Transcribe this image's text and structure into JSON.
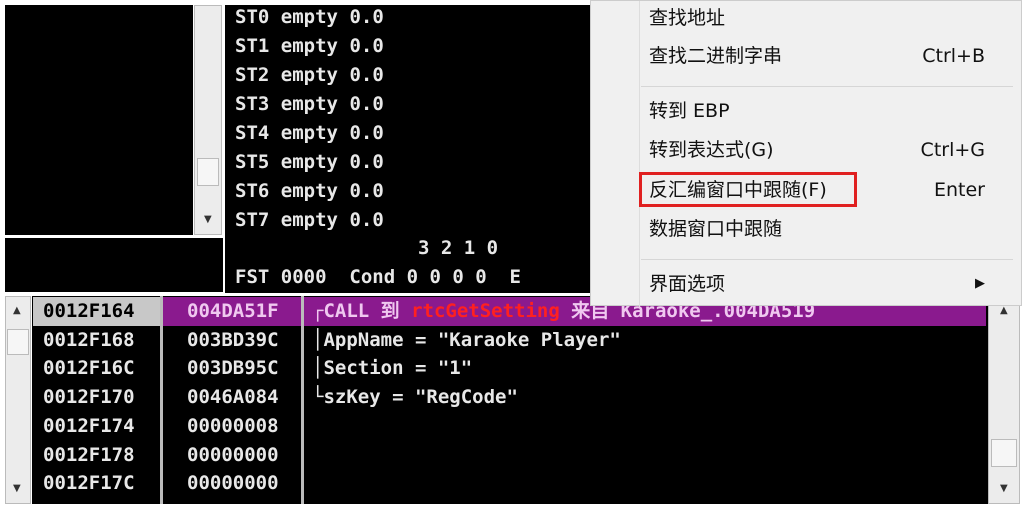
{
  "fpu": {
    "registers": [
      {
        "name": "ST0",
        "state": "empty",
        "value": "0.0"
      },
      {
        "name": "ST1",
        "state": "empty",
        "value": "0.0"
      },
      {
        "name": "ST2",
        "state": "empty",
        "value": "0.0"
      },
      {
        "name": "ST3",
        "state": "empty",
        "value": "0.0"
      },
      {
        "name": "ST4",
        "state": "empty",
        "value": "0.0"
      },
      {
        "name": "ST5",
        "state": "empty",
        "value": "0.0"
      },
      {
        "name": "ST6",
        "state": "empty",
        "value": "0.0"
      },
      {
        "name": "ST7",
        "state": "empty",
        "value": "0.0"
      }
    ],
    "bit_header": "                3 2 1 0",
    "fst_line": "FST 0000  Cond 0 0 0 0  E"
  },
  "stack": {
    "rows": [
      {
        "addr": "0012F164",
        "value": "004DA51F",
        "comment": "┌CALL 到 ",
        "func": "rtcGetSetting",
        "tail": " 来自 Karaoke_.004DA519"
      },
      {
        "addr": "0012F168",
        "value": "003BD39C",
        "comment": "│AppName = \"Karaoke Player\""
      },
      {
        "addr": "0012F16C",
        "value": "003DB95C",
        "comment": "│Section = \"1\""
      },
      {
        "addr": "0012F170",
        "value": "0046A084",
        "comment": "└szKey = \"RegCode\""
      },
      {
        "addr": "0012F174",
        "value": "00000008",
        "comment": ""
      },
      {
        "addr": "0012F178",
        "value": "00000000",
        "comment": ""
      },
      {
        "addr": "0012F17C",
        "value": "00000000",
        "comment": ""
      }
    ]
  },
  "menu": {
    "items": [
      {
        "label": "查找地址",
        "shortcut": ""
      },
      {
        "label": "查找二进制字串",
        "shortcut": "Ctrl+B"
      },
      {
        "label": "转到 EBP",
        "shortcut": ""
      },
      {
        "label": "转到表达式(G)",
        "shortcut": "Ctrl+G"
      },
      {
        "label": "反汇编窗口中跟随(F)",
        "shortcut": "Enter"
      },
      {
        "label": "数据窗口中跟随",
        "shortcut": ""
      },
      {
        "label": "界面选项",
        "shortcut": "▶"
      }
    ]
  },
  "colors": {
    "highlight_row": "#8a1a8e",
    "func_name": "#ff2020",
    "menu_highlight_box": "#e02020"
  }
}
